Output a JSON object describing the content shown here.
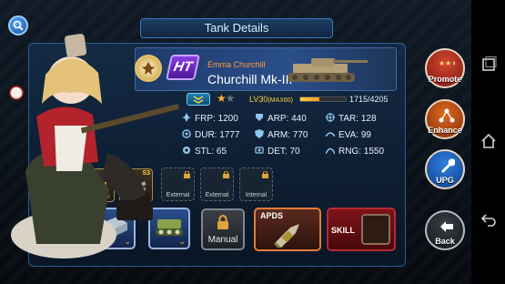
{
  "screen": {
    "title": "Tank Details"
  },
  "tank": {
    "class_badge": "HT",
    "commander": "Emma Churchill",
    "name": "Churchill Mk-III",
    "stars_on": "★",
    "stars_off": "★",
    "level": "LV30",
    "level_max": "(MAX60)",
    "exp_text": "1715/4205",
    "exp_fraction": 0.41
  },
  "stats": [
    {
      "key": "FRP",
      "value": "1200",
      "icon": "firepower-icon"
    },
    {
      "key": "ARP",
      "value": "440",
      "icon": "armor-pierce-icon"
    },
    {
      "key": "TAR",
      "value": "128",
      "icon": "target-icon"
    },
    {
      "key": "DUR",
      "value": "1777",
      "icon": "durability-icon"
    },
    {
      "key": "ARM",
      "value": "770",
      "icon": "armor-icon"
    },
    {
      "key": "EVA",
      "value": "99",
      "icon": "evasion-icon"
    },
    {
      "key": "STL",
      "value": "65",
      "icon": "stealth-icon"
    },
    {
      "key": "DET",
      "value": "70",
      "icon": "detection-icon"
    },
    {
      "key": "RNG",
      "value": "1550",
      "icon": "range-icon"
    }
  ],
  "equipment": {
    "slot1_tag": "S3",
    "slot2_tag": "S3",
    "locked_labels": [
      "External",
      "External",
      "Internal"
    ]
  },
  "actions": {
    "manual_label": "Manual",
    "shell_label": "APDS",
    "skill_label": "SKILL"
  },
  "side_buttons": {
    "promote": "Promote",
    "enhance": "Enhance",
    "upg": "UPG",
    "back": "Back"
  },
  "colors": {
    "accent": "#3a79b8",
    "commander": "#ff9d3c",
    "level": "#ffd23f",
    "skill": "#7d1319"
  }
}
